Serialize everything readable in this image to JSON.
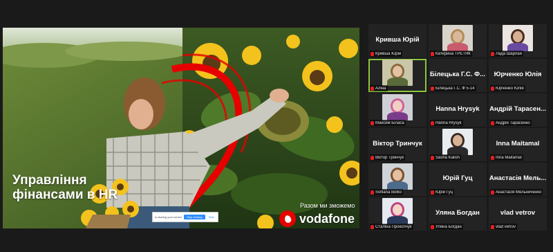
{
  "slide": {
    "title_line1": "Управління",
    "title_line2": "фінансами в HR",
    "slogan": "Разом ми зможемо",
    "brand": "vodafone",
    "share_bar": {
      "info": "is sharing your screen",
      "stop_label": "Stop sharing",
      "hide_label": "Hide"
    }
  },
  "participants": [
    {
      "name": "Кривша Юрій",
      "caption": "Кривша Юрій",
      "video": false
    },
    {
      "name": "",
      "caption": "Катерина ТРЕТЯК",
      "video": true
    },
    {
      "name": "",
      "caption": "Лада Шарлай",
      "video": true
    },
    {
      "name": "",
      "caption": "Аліна",
      "video": true,
      "active": true
    },
    {
      "name": "Білецька Г.С. Ф...",
      "caption": "Білецька Г.С. Ф 5-14",
      "video": false
    },
    {
      "name": "Юрченко Юлія",
      "caption": "Юрченко Юлія",
      "video": false
    },
    {
      "name": "",
      "caption": "Максим Біласа",
      "video": true
    },
    {
      "name": "Hanna Hrysyk",
      "caption": "Hanna Hrysyk",
      "video": false
    },
    {
      "name": "Андрій Тарасен...",
      "caption": "Андрій Тарасенко",
      "video": false
    },
    {
      "name": "Віктор Тринчук",
      "caption": "Віктор Тринчук",
      "video": false
    },
    {
      "name": "",
      "caption": "Sasha Kalish",
      "video": true
    },
    {
      "name": "Inna Maitamal",
      "caption": "Inna Maitamal",
      "video": false
    },
    {
      "name": "",
      "caption": "Svitlana Bolko",
      "video": true
    },
    {
      "name": "Юрій Гуц",
      "caption": "Юрій Гуц",
      "video": false
    },
    {
      "name": "Анастасія Мель...",
      "caption": "Анастасія Мельниченко",
      "video": false
    },
    {
      "name": "",
      "caption": "Сталіна Прокопчук",
      "video": true
    },
    {
      "name": "Уляна Богдан",
      "caption": "Уляна Богдан",
      "video": false
    },
    {
      "name": "vlad vetrov",
      "caption": "vlad vetrov",
      "video": false
    }
  ],
  "colors": {
    "vodafone_red": "#e60000",
    "active_speaker": "#8cc63f",
    "muted_mic": "#e02020",
    "tile_bg": "#232323"
  },
  "icons": [
    "muted-mic-icon",
    "vodafone-logo"
  ]
}
